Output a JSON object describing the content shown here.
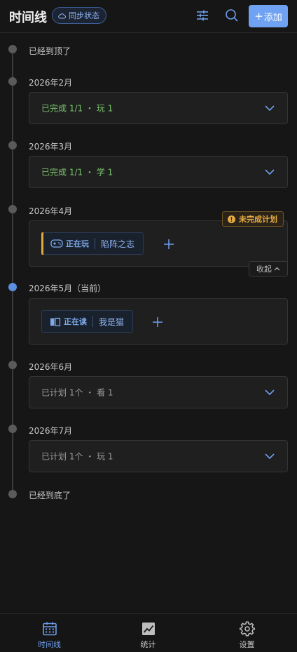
{
  "header": {
    "title": "时间线",
    "sync_label": "同步状态",
    "add_label": "添加",
    "add_plus": "+"
  },
  "timeline": {
    "top_end": "已经到顶了",
    "bottom_end": "已经到底了",
    "months": [
      {
        "label": "2026年2月",
        "summary": "已完成 1/1 ・ 玩 1",
        "state": "done"
      },
      {
        "label": "2026年3月",
        "summary": "已完成 1/1 ・ 学 1",
        "state": "done"
      },
      {
        "label": "2026年4月",
        "badge": "未完成计划",
        "collapse_label": "收起",
        "items": [
          {
            "status": "正在玩",
            "name": "陷阵之志",
            "icon": "gamepad-icon"
          }
        ]
      },
      {
        "label": "2026年5月（当前）",
        "current": true,
        "items": [
          {
            "status": "正在读",
            "name": "我是猫",
            "icon": "book-icon"
          }
        ]
      },
      {
        "label": "2026年6月",
        "summary": "已计划 1个 ・ 看 1",
        "state": "planned"
      },
      {
        "label": "2026年7月",
        "summary": "已计划 1个 ・ 玩 1",
        "state": "planned"
      }
    ]
  },
  "bottom_nav": [
    {
      "label": "时间线",
      "icon": "calendar-icon",
      "active": true
    },
    {
      "label": "统计",
      "icon": "chart-icon",
      "active": false
    },
    {
      "label": "设置",
      "icon": "gear-icon",
      "active": false
    }
  ],
  "colors": {
    "accent": "#6fa2f2",
    "done": "#78c26a",
    "warning": "#e4ab45",
    "background": "#161616"
  }
}
